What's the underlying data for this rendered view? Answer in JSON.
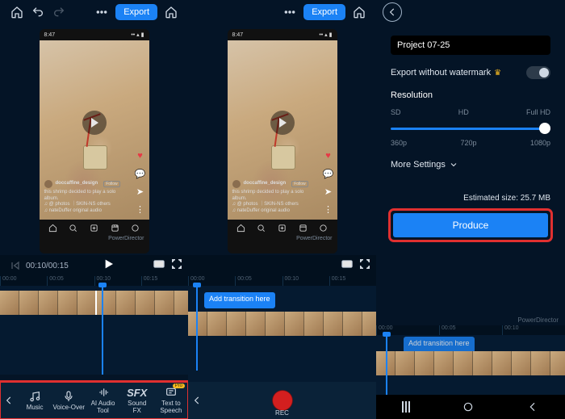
{
  "colors": {
    "accent": "#1b82f5",
    "danger_outline": "#e03030",
    "bg": "#041426"
  },
  "header": {
    "export_label": "Export",
    "phone_time": "8:47"
  },
  "preview": {
    "username": "doccaffine_design",
    "follow": "Follow",
    "caption_line1": "this shrimp decided to play a solo album.",
    "caption_line2": "♫ @ photos ｜SKIN-NS others",
    "audio_note": "♫ nateDuffer original audio",
    "credit": "PowerDirector"
  },
  "controls": {
    "timecode": "00:10/00:15"
  },
  "ruler": {
    "ticks": [
      "00:00",
      "00:05",
      "00:10",
      "00:15"
    ]
  },
  "timeline": {
    "playhead_left_pct": 54,
    "transition_label": "Add transition here"
  },
  "toolbar": {
    "music": "Music",
    "voiceover": "Voice-Over",
    "ai_audio": "AI Audio\nTool",
    "soundfx": "Sound\nFX",
    "tts": "Text to\nSpeech",
    "pro_badge": "Pro",
    "rec_label": "REC"
  },
  "export_panel": {
    "project_name": "Project 07-25",
    "watermark_label": "Export without watermark",
    "resolution_title": "Resolution",
    "res_top": [
      "SD",
      "HD",
      "Full HD"
    ],
    "res_bottom": [
      "360p",
      "720p",
      "1080p"
    ],
    "more_settings": "More Settings",
    "estimated_label": "Estimated size: 25.7 MB",
    "produce_label": "Produce"
  }
}
